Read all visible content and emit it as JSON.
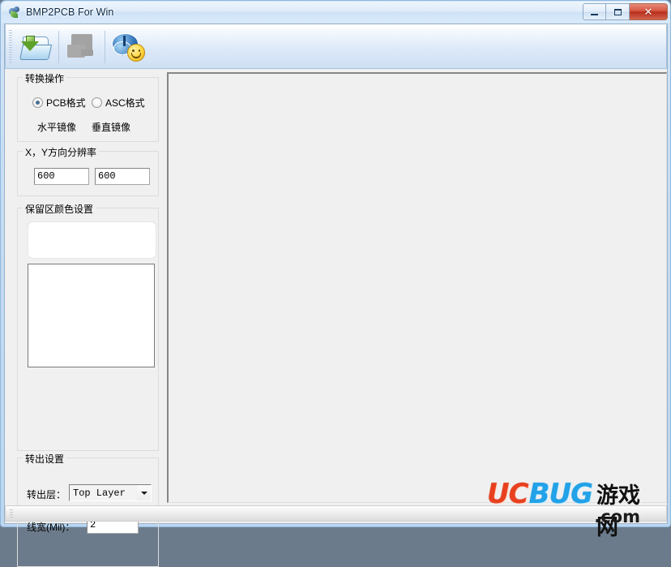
{
  "window": {
    "title": "BMP2PCB For Win",
    "icon": "app-icon",
    "controls": {
      "minimize": "–",
      "maximize": "□",
      "close": "✕"
    }
  },
  "toolbar": {
    "buttons": [
      {
        "name": "open-file-button",
        "icon": "open-folder-icon",
        "enabled": true
      },
      {
        "name": "save-file-button",
        "icon": "save-disabled-icon",
        "enabled": false
      },
      {
        "name": "about-button",
        "icon": "chat-smiley-icon",
        "enabled": true
      }
    ]
  },
  "panels": {
    "convert": {
      "legend": "转换操作",
      "radios": [
        {
          "label": "PCB格式",
          "selected": true
        },
        {
          "label": "ASC格式",
          "selected": false
        }
      ],
      "mirror_horizontal": "水平镜像",
      "mirror_vertical": "垂直镜像"
    },
    "resolution": {
      "legend": "X，Y方向分辨率",
      "x_value": "600",
      "y_value": "600"
    },
    "reserve_color": {
      "legend": "保留区颜色设置",
      "preview_color": "#ffffff",
      "list_color": "#ffffff"
    },
    "export": {
      "legend": "转出设置",
      "layer_label": "转出层：",
      "layer_value": "Top  Layer",
      "layer_options": [
        "Top  Layer"
      ],
      "width_label": "线宽(Mil)：",
      "width_value": "2"
    }
  },
  "canvas": {
    "background": "#f0f0f0"
  },
  "statusbar": {
    "text": ""
  },
  "watermark": {
    "uc": "UC",
    "bug": "BUG",
    "cn": "游戏网",
    "dot": ".com"
  }
}
